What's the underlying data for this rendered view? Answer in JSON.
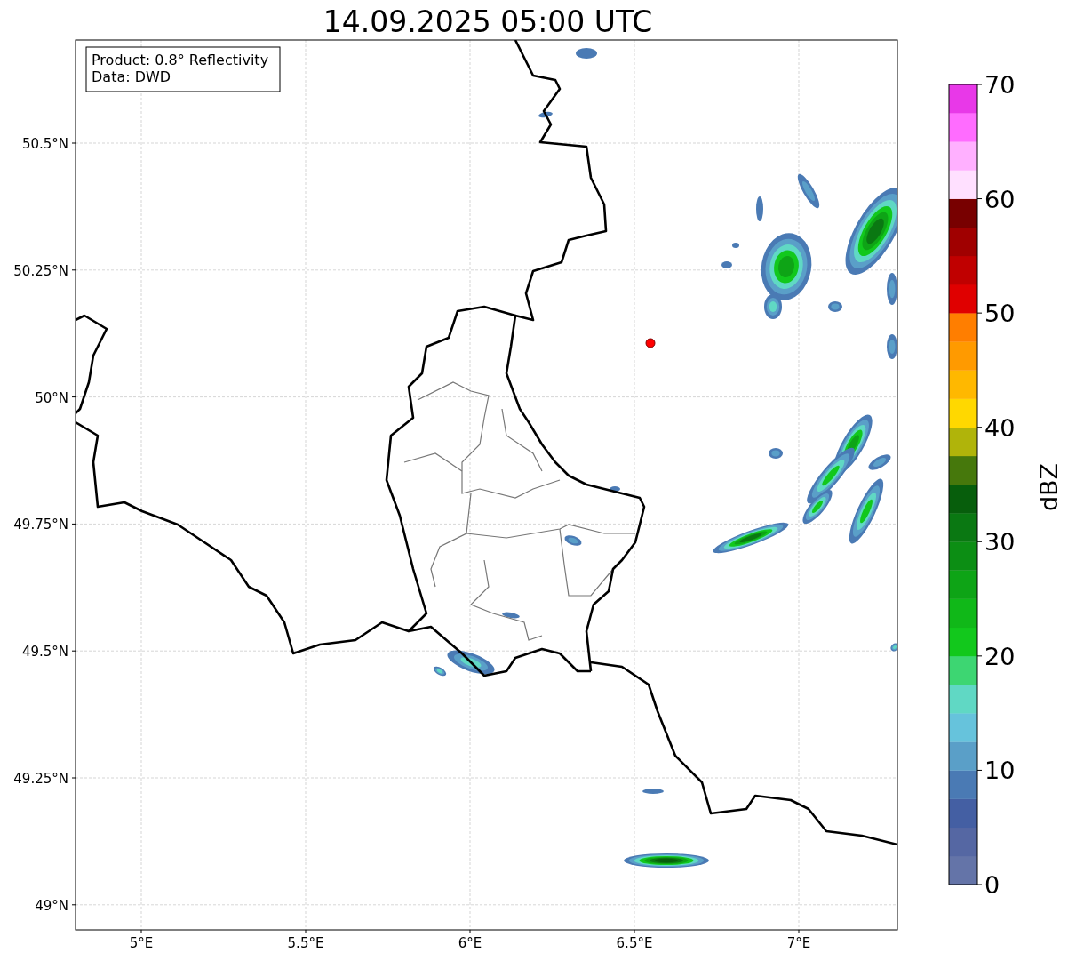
{
  "title": "14.09.2025 05:00 UTC",
  "info_box": {
    "lines": [
      "Product: 0.8° Reflectivity",
      "Data: DWD"
    ]
  },
  "map": {
    "x_tick_labels": [
      "5°E",
      "5.5°E",
      "6°E",
      "6.5°E",
      "7°E"
    ],
    "y_tick_labels": [
      "50.5°N",
      "50.25°N",
      "50°N",
      "49.75°N",
      "49.5°N",
      "49.25°N",
      "49°N"
    ]
  },
  "colorbar": {
    "label": "dBZ",
    "tick_labels": [
      "70",
      "60",
      "50",
      "40",
      "30",
      "20",
      "10",
      "0"
    ],
    "bins": [
      {
        "color": "#6474a8"
      },
      {
        "color": "#5567a3"
      },
      {
        "color": "#445fa3"
      },
      {
        "color": "#4a7ab4"
      },
      {
        "color": "#5a9fc8"
      },
      {
        "color": "#66c3dc"
      },
      {
        "color": "#60d8c4"
      },
      {
        "color": "#3dd672"
      },
      {
        "color": "#12c81c"
      },
      {
        "color": "#10b818"
      },
      {
        "color": "#0ea416"
      },
      {
        "color": "#0c8e14"
      },
      {
        "color": "#0a7812"
      },
      {
        "color": "#075e0c"
      },
      {
        "color": "#46780c"
      },
      {
        "color": "#b0b40a"
      },
      {
        "color": "#ffd800"
      },
      {
        "color": "#ffb800"
      },
      {
        "color": "#ff9a00"
      },
      {
        "color": "#ff7e00"
      },
      {
        "color": "#e00000"
      },
      {
        "color": "#c00000"
      },
      {
        "color": "#a00000"
      },
      {
        "color": "#780000"
      },
      {
        "color": "#ffe0ff"
      },
      {
        "color": "#ffb0ff"
      },
      {
        "color": "#ff6cff"
      },
      {
        "color": "#e838e8"
      }
    ]
  }
}
